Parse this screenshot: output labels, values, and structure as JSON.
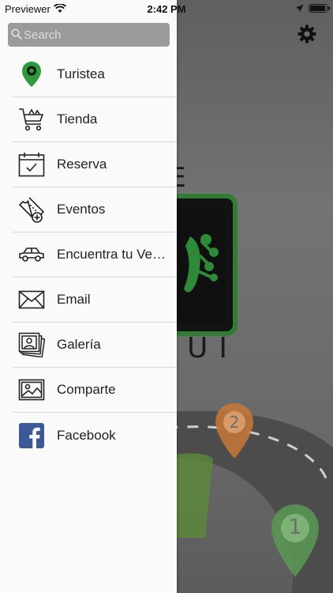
{
  "status_bar": {
    "carrier": "Previewer",
    "time": "2:42 PM"
  },
  "drawer": {
    "search": {
      "placeholder": "Search"
    },
    "items": [
      {
        "label": "Turistea",
        "icon": "map-pin-icon"
      },
      {
        "label": "Tienda",
        "icon": "shopping-cart-icon"
      },
      {
        "label": "Reserva",
        "icon": "calendar-check-icon"
      },
      {
        "label": "Eventos",
        "icon": "ticket-add-icon"
      },
      {
        "label": "Encuentra tu Ve…",
        "icon": "car-icon"
      },
      {
        "label": "Email",
        "icon": "envelope-icon"
      },
      {
        "label": "Galería",
        "icon": "photo-gallery-icon"
      },
      {
        "label": "Comparte",
        "icon": "image-share-icon"
      },
      {
        "label": "Facebook",
        "icon": "facebook-icon"
      }
    ]
  },
  "background": {
    "title_top": "ACE",
    "title_bottom": "RUI",
    "pin_2": "2",
    "pin_1": "1"
  },
  "colors": {
    "accent_green": "#2e9a3c",
    "facebook_blue": "#3b5998",
    "pin_orange": "#c8783a",
    "pin_green": "#5a9a52"
  }
}
